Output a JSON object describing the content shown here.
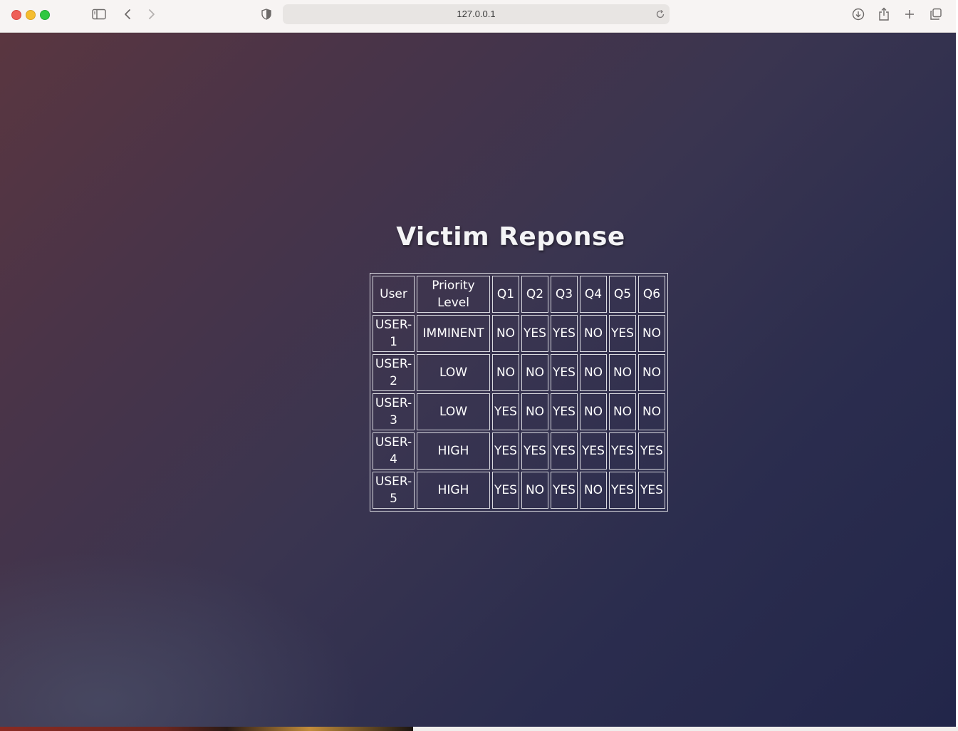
{
  "browser": {
    "url": "127.0.0.1"
  },
  "page": {
    "title": "Victim Reponse"
  },
  "table": {
    "headers": [
      "User",
      "Priority Level",
      "Q1",
      "Q2",
      "Q3",
      "Q4",
      "Q5",
      "Q6"
    ],
    "rows": [
      [
        "USER-1",
        "IMMINENT",
        "NO",
        "YES",
        "YES",
        "NO",
        "YES",
        "NO"
      ],
      [
        "USER-2",
        "LOW",
        "NO",
        "NO",
        "YES",
        "NO",
        "NO",
        "NO"
      ],
      [
        "USER-3",
        "LOW",
        "YES",
        "NO",
        "YES",
        "NO",
        "NO",
        "NO"
      ],
      [
        "USER-4",
        "HIGH",
        "YES",
        "YES",
        "YES",
        "YES",
        "YES",
        "YES"
      ],
      [
        "USER-5",
        "HIGH",
        "YES",
        "NO",
        "YES",
        "NO",
        "YES",
        "YES"
      ]
    ]
  },
  "icons": {
    "sidebar": "sidebar-icon",
    "back": "chevron-left-icon",
    "forward": "chevron-right-icon",
    "privacy": "shield-icon",
    "reload": "reload-icon",
    "downloads": "download-icon",
    "share": "share-icon",
    "new_tab": "plus-icon",
    "tabs": "tabs-overview-icon"
  }
}
